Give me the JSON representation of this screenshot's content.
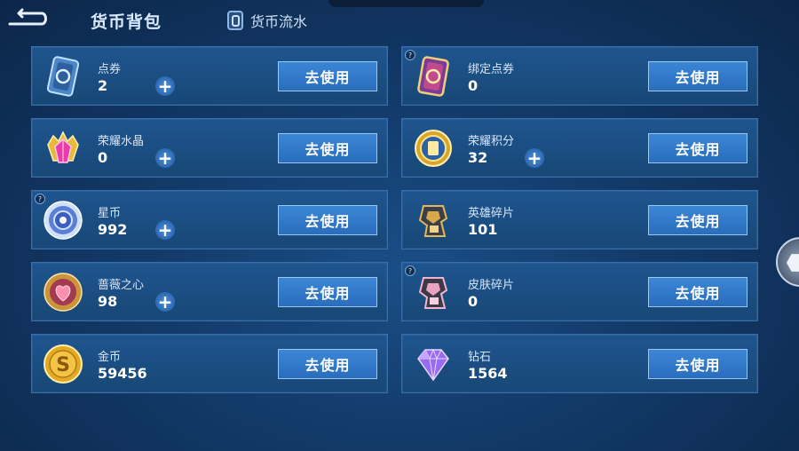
{
  "header": {
    "title": "货币背包",
    "flow_label": "货币流水"
  },
  "cards": [
    {
      "name": "点券",
      "count": "2",
      "button": "去使用"
    },
    {
      "name": "绑定点券",
      "count": "0",
      "button": "去使用"
    },
    {
      "name": "荣耀水晶",
      "count": "0",
      "button": "去使用"
    },
    {
      "name": "荣耀积分",
      "count": "32",
      "button": "去使用"
    },
    {
      "name": "星币",
      "count": "992",
      "button": "去使用"
    },
    {
      "name": "英雄碎片",
      "count": "101",
      "button": "去使用"
    },
    {
      "name": "蔷薇之心",
      "count": "98",
      "button": "去使用"
    },
    {
      "name": "皮肤碎片",
      "count": "0",
      "button": "去使用"
    },
    {
      "name": "金币",
      "count": "59456",
      "button": "去使用"
    },
    {
      "name": "钻石",
      "count": "1564",
      "button": "去使用"
    }
  ],
  "plus_symbol": "+",
  "help_symbol": "?",
  "icons": [
    "voucher-icon",
    "bound-voucher-icon",
    "honor-crystal-icon",
    "honor-points-icon",
    "star-coin-icon",
    "hero-fragment-icon",
    "rose-heart-icon",
    "skin-fragment-icon",
    "gold-coin-icon",
    "diamond-icon"
  ],
  "colors": {
    "accent": "#2f74c6",
    "panel": "#1a4c80",
    "border": "#3a6ea8"
  }
}
